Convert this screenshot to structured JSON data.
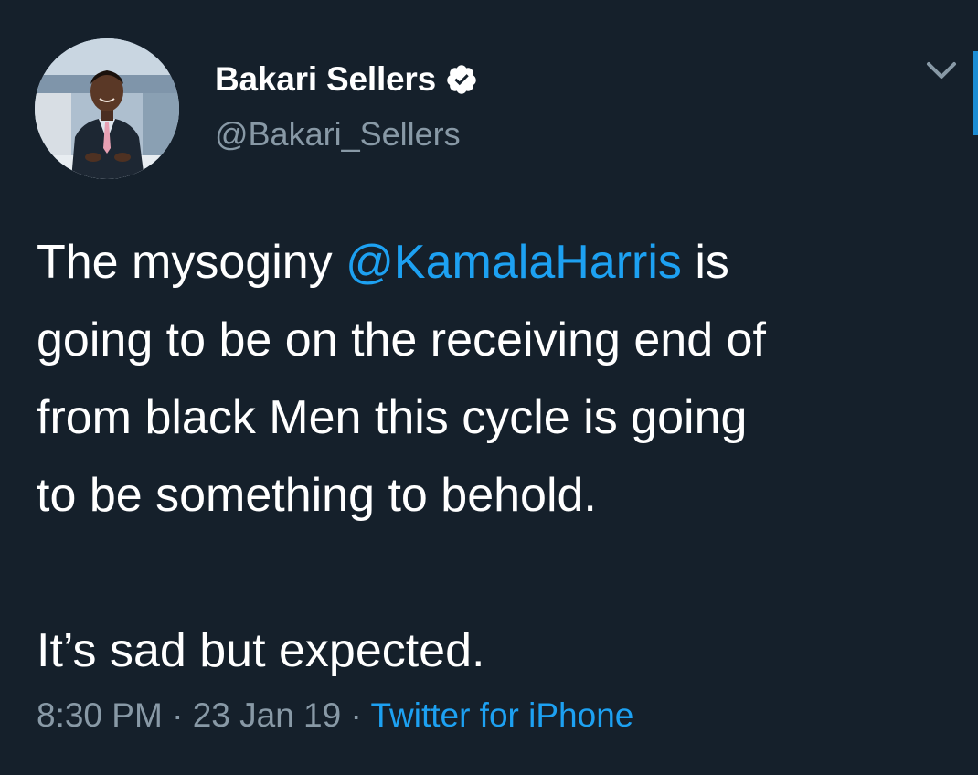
{
  "tweet": {
    "author": {
      "display_name": "Bakari Sellers",
      "handle": "@Bakari_Sellers",
      "verified": true,
      "avatar_icon": "profile-photo"
    },
    "body": {
      "line1_pre": "The mysoginy ",
      "mention": "@KamalaHarris",
      "line1_post": " is",
      "line2": "going to be on the receiving end of",
      "line3": "from black Men this cycle is going",
      "line4": "to be something to behold.",
      "line5": "It’s sad but expected."
    },
    "meta": {
      "time": "8:30 PM",
      "sep1": " · ",
      "date": "23 Jan 19",
      "sep2": " · ",
      "source": "Twitter for iPhone"
    },
    "menu_icon": "chevron-down-icon",
    "colors": {
      "background": "#15202b",
      "text": "#ffffff",
      "secondary": "#8899a6",
      "accent": "#1da1f2"
    }
  }
}
